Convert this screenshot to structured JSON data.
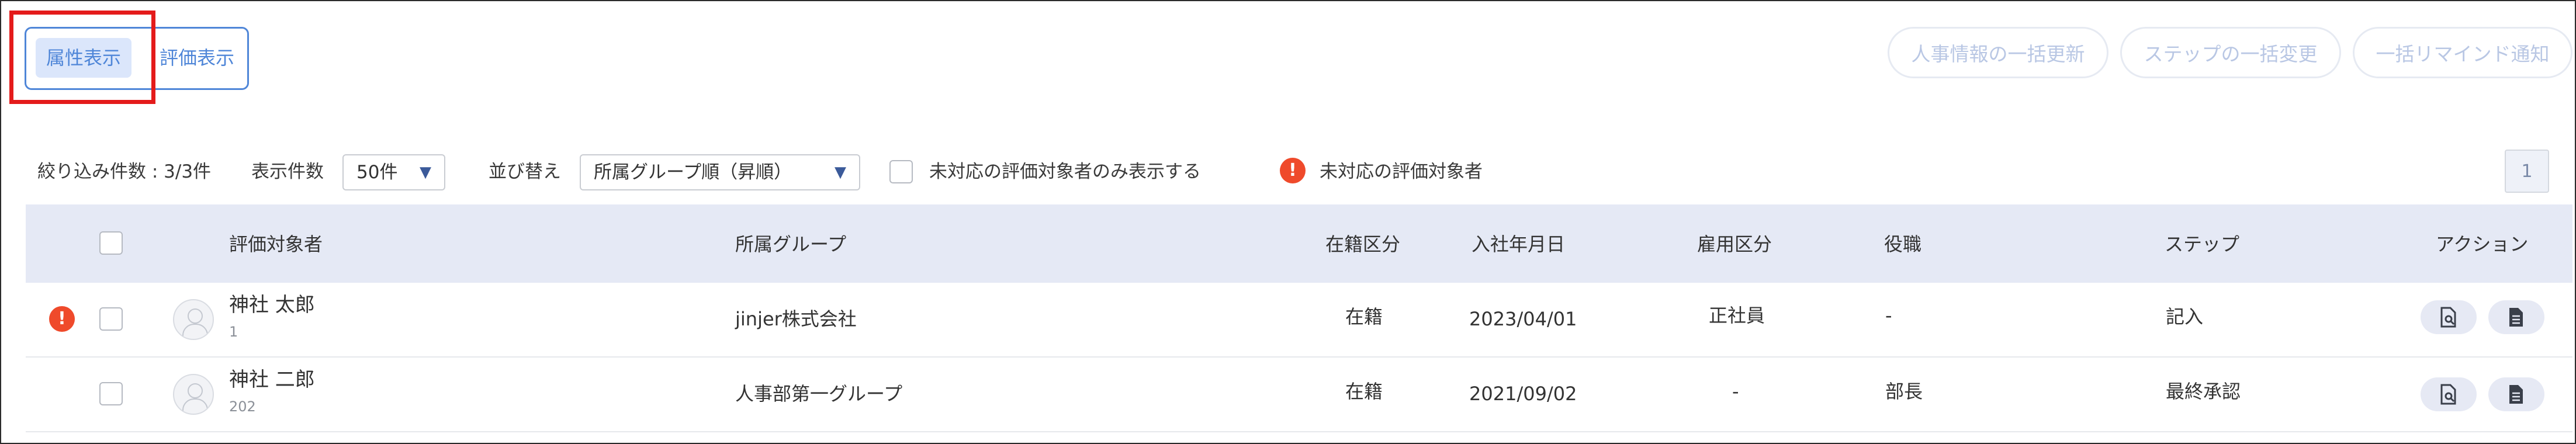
{
  "toolbar": {
    "view_attributes": "属性表示",
    "view_evaluation": "評価表示",
    "bulk_update_hr": "人事情報の一括更新",
    "bulk_change_step": "ステップの一括変更",
    "bulk_remind": "一括リマインド通知"
  },
  "filters": {
    "count_label": "絞り込み件数 : 3/3件",
    "display_count_label": "表示件数",
    "display_count_value": "50件",
    "sort_label": "並び替え",
    "sort_value": "所属グループ順（昇順）",
    "unhandled_only_label": "未対応の評価対象者のみ表示する",
    "legend_label": "未対応の評価対象者"
  },
  "pagination": {
    "current_page": "1"
  },
  "table": {
    "headers": {
      "target": "評価対象者",
      "group": "所属グループ",
      "status": "在籍区分",
      "join_date": "入社年月日",
      "employment": "雇用区分",
      "position": "役職",
      "step": "ステップ",
      "actions": "アクション"
    },
    "rows": [
      {
        "unhandled": true,
        "name": "神社 太郎",
        "id": "1",
        "group": "jinjer株式会社",
        "status": "在籍",
        "join_date": "2023/04/01",
        "employment": "正社員",
        "position": "-",
        "step": "記入"
      },
      {
        "unhandled": false,
        "name": "神社 二郎",
        "id": "202",
        "group": "人事部第一グループ",
        "status": "在籍",
        "join_date": "2021/09/02",
        "employment": "-",
        "position": "部長",
        "step": "最終承認"
      }
    ]
  },
  "icons": {
    "alert": "exclamation-circle-icon",
    "preview": "document-search-icon",
    "document": "document-icon",
    "avatar": "user-placeholder-icon",
    "caret": "caret-down-icon"
  },
  "colors": {
    "accent": "#4f86d8",
    "alert": "#ef4a2b",
    "highlight": "#e41b1b",
    "header_bg": "#e5e9f5"
  }
}
